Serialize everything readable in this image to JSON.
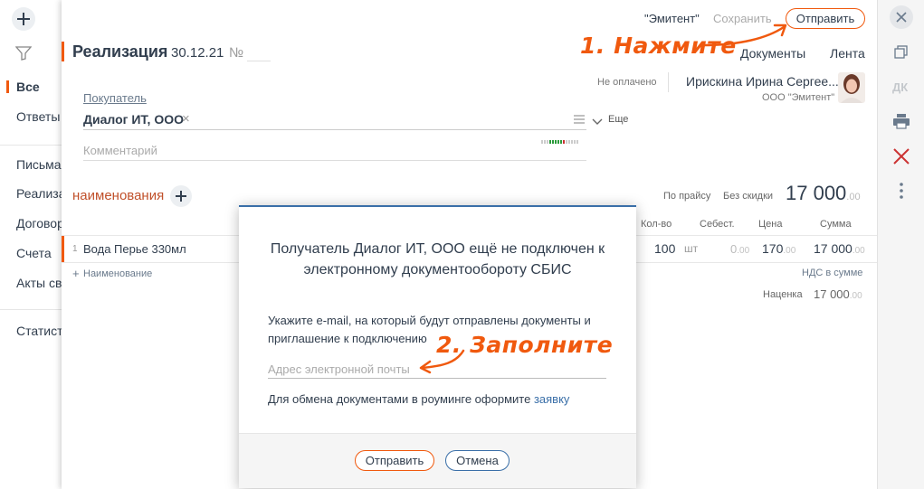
{
  "sidebar": {
    "items": [
      {
        "label": "Все"
      },
      {
        "label": "Ответы"
      },
      {
        "label": "Письма"
      },
      {
        "label": "Реализация"
      },
      {
        "label": "Договоры"
      },
      {
        "label": "Счета"
      },
      {
        "label": "Акты сверки"
      },
      {
        "label": "Статистика"
      }
    ]
  },
  "header": {
    "org_label": "\"Эмитент\"",
    "save_label": "Сохранить",
    "send_label": "Отправить",
    "doc_title": "Реализация",
    "doc_date": "30.12.21",
    "number_label": "№",
    "documents_tab": "Документы",
    "feed_tab": "Лента"
  },
  "annotations": {
    "step1": "1. Нажмите",
    "step2": "2. Заполните"
  },
  "status": {
    "payment": "Не оплачено",
    "user_name": "Ирискина Ирина Сергее...",
    "user_org": "ООО \"Эмитент\""
  },
  "form": {
    "buyer_label": "Покупатель",
    "buyer_value": "Диалог ИТ, ООО",
    "more_label": "Еще",
    "comment_placeholder": "Комментарий"
  },
  "items": {
    "section_label": "наименования",
    "price_mode": "По прайсу",
    "discount_mode": "Без скидки",
    "total_main": "17 000",
    "total_cents": ".00",
    "columns": {
      "qty": "Кол-во",
      "cost": "Себест.",
      "price": "Цена",
      "sum": "Сумма"
    },
    "rows": [
      {
        "index": "1",
        "name": "Вода Перье 330мл",
        "qty": "100",
        "unit": "шт",
        "cost": "0",
        "cost_cents": ".00",
        "price": "170",
        "price_cents": ".00",
        "sum": "17 000",
        "sum_cents": ".00"
      }
    ],
    "add_item_label": "Наименование",
    "vat_label": "НДС в сумме",
    "markup_label": "Наценка",
    "markup_value": "17 000",
    "markup_cents": ".00"
  },
  "dialog": {
    "title": "Получатель Диалог ИТ, ООО ещё не подключен к электронному документообороту СБИС",
    "instruction": "Укажите e-mail, на который будут отправлены документы и приглашение к подключению",
    "email_placeholder": "Адрес электронной почты",
    "roaming_text": "Для обмена документами в роуминге оформите",
    "roaming_link": "заявку",
    "send_label": "Отправить",
    "cancel_label": "Отмена"
  },
  "right_sidebar": {
    "dk_label": "ДК"
  },
  "colors": {
    "accent": "#f0590e",
    "link_blue": "#3a6fa8",
    "danger": "#c33"
  }
}
